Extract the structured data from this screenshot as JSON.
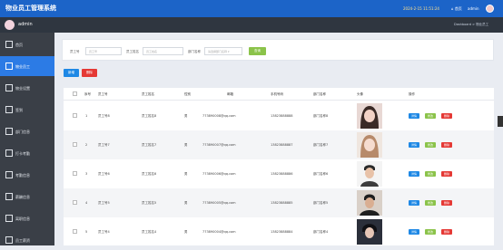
{
  "app": {
    "title": "物业员工管理系统",
    "datetime": "2024-2-15 11:51:24",
    "home_label": "首页",
    "user_label": "admin"
  },
  "userbar": {
    "name": "admin",
    "breadcrumb": "Dashboard > 物业员工"
  },
  "sidebar": {
    "items": [
      {
        "label": "首页",
        "icon": "home-icon"
      },
      {
        "label": "物业员工",
        "icon": "grid-icon",
        "active": true
      },
      {
        "label": "物业设置",
        "icon": "grid-icon"
      },
      {
        "label": "签到",
        "icon": "grid-icon"
      },
      {
        "label": "部门信息",
        "icon": "grid-icon"
      },
      {
        "label": "打卡考勤",
        "icon": "grid-icon"
      },
      {
        "label": "考勤信息",
        "icon": "grid-icon"
      },
      {
        "label": "薪酬信息",
        "icon": "grid-icon"
      },
      {
        "label": "离职信息",
        "icon": "send-icon"
      },
      {
        "label": "员工薪资",
        "icon": "grid-icon"
      }
    ]
  },
  "search": {
    "emp_no_label": "员工号",
    "emp_no_placeholder": "员工号",
    "emp_name_label": "员工姓名",
    "emp_name_placeholder": "员工姓名",
    "dept_label": "部门名称",
    "dept_placeholder": "请选择部门名称",
    "query_label": "查询"
  },
  "actions": {
    "add_label": "新增",
    "delete_label": "删除"
  },
  "table": {
    "headers": [
      "序号",
      "员工号",
      "员工姓名",
      "性别",
      "邮箱",
      "手机号码",
      "部门名称",
      "头像",
      "操作"
    ],
    "rows": [
      {
        "idx": "1",
        "no": "员工号8",
        "name": "员工姓名8",
        "gender": "男",
        "email": "773890008@qq.com",
        "phone": "13823888888",
        "dept": "部门名称8"
      },
      {
        "idx": "2",
        "no": "员工号7",
        "name": "员工姓名7",
        "gender": "男",
        "email": "773890007@qq.com",
        "phone": "13823888887",
        "dept": "部门名称7"
      },
      {
        "idx": "3",
        "no": "员工号6",
        "name": "员工姓名6",
        "gender": "男",
        "email": "773890006@qq.com",
        "phone": "13823888886",
        "dept": "部门名称6"
      },
      {
        "idx": "4",
        "no": "员工号5",
        "name": "员工姓名5",
        "gender": "男",
        "email": "773890005@qq.com",
        "phone": "13823888885",
        "dept": "部门名称5"
      },
      {
        "idx": "5",
        "no": "员工号4",
        "name": "员工姓名4",
        "gender": "男",
        "email": "773890004@qq.com",
        "phone": "13823888884",
        "dept": "部门名称4"
      }
    ],
    "op_detail": "详情",
    "op_edit": "修改",
    "op_delete": "删除"
  },
  "colors": {
    "primary": "#1c64c8",
    "sidebar": "#3a3f47",
    "active": "#2c7be5",
    "green": "#8bc34a",
    "red": "#e53935"
  }
}
